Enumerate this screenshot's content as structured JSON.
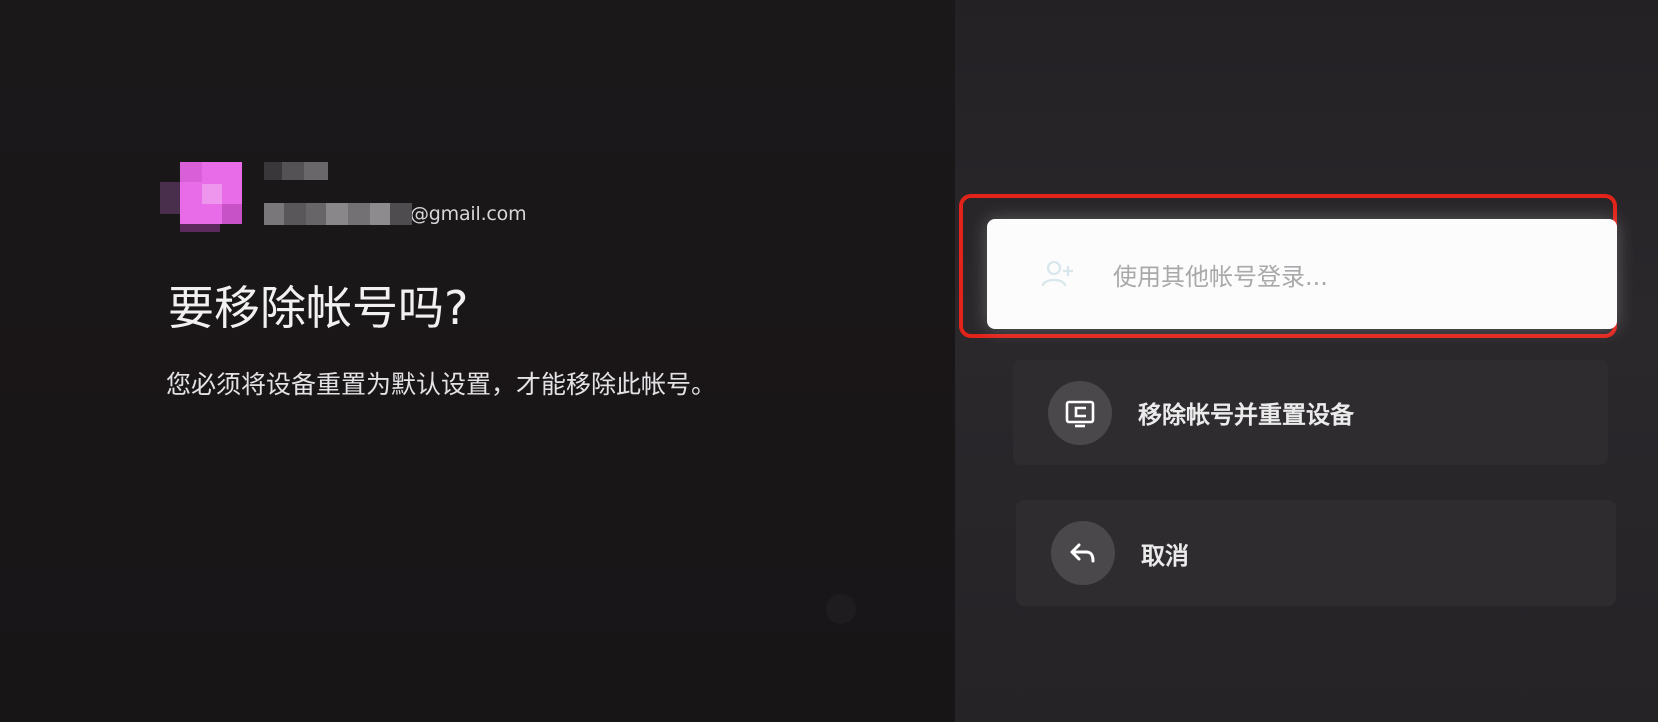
{
  "account": {
    "email_domain": "@gmail.com"
  },
  "dialog": {
    "title": "要移除帐号吗?",
    "description": "您必须将设备重置为默认设置，才能移除此帐号。"
  },
  "options": {
    "sign_in_other": {
      "label": "使用其他帐号登录...",
      "icon": "person-add-icon"
    },
    "remove_and_reset": {
      "label": "移除帐号并重置设备",
      "icon": "reset-device-icon"
    },
    "cancel": {
      "label": "取消",
      "icon": "back-arrow-icon"
    }
  },
  "colors": {
    "highlight_frame": "#e2231a",
    "avatar": "#e86be8",
    "focused_option_bg": "#fcfcfc"
  }
}
